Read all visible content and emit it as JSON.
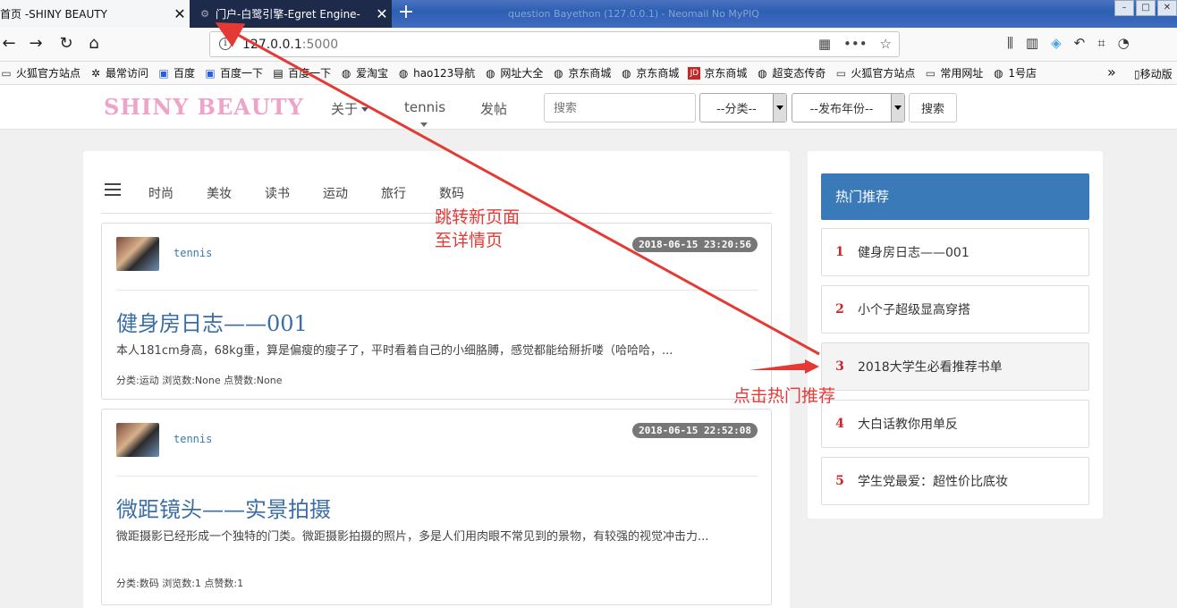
{
  "browser": {
    "tabs": [
      {
        "title": "首页 -SHINY BEAUTY",
        "active": true
      },
      {
        "title": "门户-白鹭引擎-Egret Engine-",
        "active": false
      }
    ],
    "background_tab_title": "question Bayethon (127.0.0.1) - Neomail No MyPIQ",
    "url": {
      "host": "127.0.0.1",
      "port": ":5000"
    },
    "bookmarks": [
      {
        "label": "火狐官方站点",
        "icon": "folder-icon"
      },
      {
        "label": "最常访问",
        "icon": "gear-icon"
      },
      {
        "label": "百度",
        "icon": "baidu-icon"
      },
      {
        "label": "百度一下",
        "icon": "baidu-icon"
      },
      {
        "label": "百度一下",
        "icon": "page-icon"
      },
      {
        "label": "爱淘宝",
        "icon": "globe-icon"
      },
      {
        "label": "hao123导航",
        "icon": "globe-icon"
      },
      {
        "label": "网址大全",
        "icon": "globe-icon"
      },
      {
        "label": "京东商城",
        "icon": "globe-icon"
      },
      {
        "label": "京东商城",
        "icon": "globe-icon"
      },
      {
        "label": "京东商城",
        "icon": "jd-icon"
      },
      {
        "label": "超变态传奇",
        "icon": "globe-icon"
      },
      {
        "label": "火狐官方站点",
        "icon": "folder-icon"
      },
      {
        "label": "常用网址",
        "icon": "folder-icon"
      },
      {
        "label": "1号店",
        "icon": "globe-icon"
      }
    ],
    "bookmarks_more": "»",
    "mobile_bookmarks": "移动版"
  },
  "site": {
    "logo": "SHINY BEAUTY",
    "nav": {
      "about": "关于",
      "user": "tennis",
      "post": "发帖"
    },
    "search_placeholder": "搜索",
    "category_select": "--分类--",
    "year_select": "--发布年份--",
    "search_button": "搜索"
  },
  "categories": [
    "时尚",
    "美妆",
    "读书",
    "运动",
    "旅行",
    "数码"
  ],
  "posts": [
    {
      "author": "tennis",
      "date": "2018-06-15 23:20:56",
      "title": "健身房日志——001",
      "summary": "本人181cm身高，68kg重，算是偏瘦的瘦子了，平时看着自己的小细胳膊，感觉都能给掰折喽（哈哈哈，...",
      "meta": "分类:运动 浏览数:None 点赞数:None"
    },
    {
      "author": "tennis",
      "date": "2018-06-15 22:52:08",
      "title": "微距镜头——实景拍摄",
      "summary": "微距摄影已经形成一个独特的门类。微距摄影拍摄的照片，多是人们用肉眼不常见到的景物，有较强的视觉冲击力...",
      "meta": "分类:数码 浏览数:1 点赞数:1"
    }
  ],
  "sidebar": {
    "title": "热门推荐",
    "items": [
      {
        "rank": "1",
        "label": "健身房日志——001"
      },
      {
        "rank": "2",
        "label": "小个子超级显高穿搭"
      },
      {
        "rank": "3",
        "label": "2018大学生必看推荐书单"
      },
      {
        "rank": "4",
        "label": "大白话教你用单反"
      },
      {
        "rank": "5",
        "label": "学生党最爱：超性价比底妆"
      }
    ]
  },
  "annotations": {
    "jump_line1": "跳转新页面",
    "jump_line2": "至详情页",
    "click_hot": "点击热门推荐",
    "color": "#e53935"
  }
}
